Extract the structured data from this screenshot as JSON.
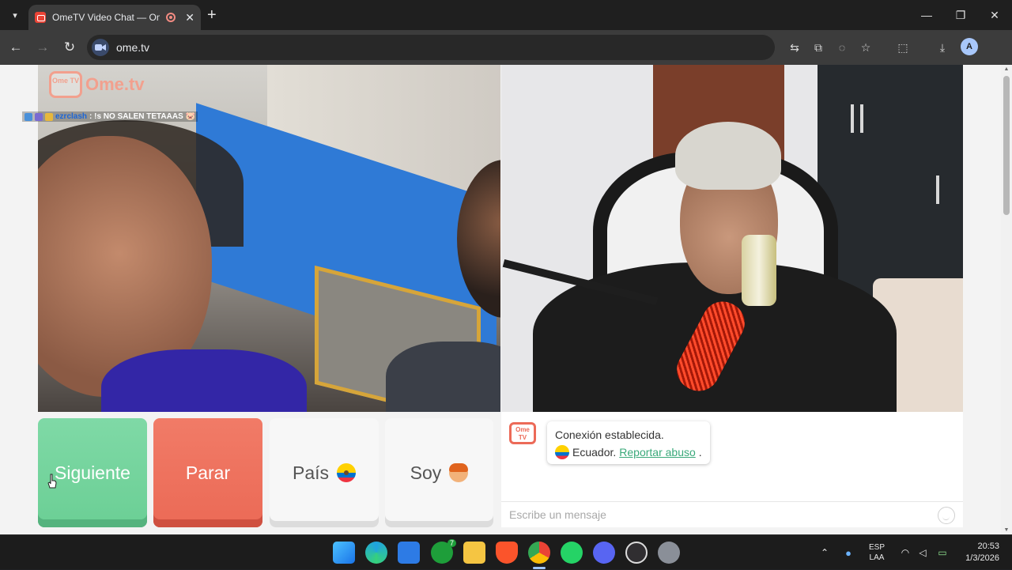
{
  "browser": {
    "tab_title": "OmeTV Video Chat — Ome",
    "tab_close": "✕",
    "new_tab": "+",
    "url": "ome.tv",
    "window_controls": {
      "minimize": "—",
      "maximize": "❐",
      "close": "✕"
    },
    "profile_initial": "A"
  },
  "left_video": {
    "logo_badge": "Ome TV",
    "logo_text": "Ome.tv",
    "overlay_user": "ezrclash",
    "overlay_text": ": !s NO SALEN TETAAAS 🐷"
  },
  "controls": {
    "next_label": "Siguiente",
    "stop_label": "Parar",
    "country_label": "País",
    "gender_label": "Soy"
  },
  "chat": {
    "bot_badge": "Ome TV",
    "status": "Conexión establecida.",
    "country": "Ecuador.",
    "report_link": "Reportar abuso",
    "report_suffix": ".",
    "input_placeholder": "Escribe un mensaje"
  },
  "taskbar": {
    "apps": [
      "windows-start",
      "edge",
      "microsoft-store",
      "xbox",
      "file-explorer",
      "brave",
      "chrome",
      "whatsapp",
      "discord",
      "obs",
      "settings"
    ],
    "xbox_badge": "7",
    "language_top": "ESP",
    "language_bottom": "LAA",
    "time": "20:53",
    "date": "1/3/2026"
  },
  "colors": {
    "next_green": "#6bcf95",
    "stop_red": "#eb6a56",
    "link_green": "#3aa97a",
    "ome_orange": "#ec6a58"
  }
}
